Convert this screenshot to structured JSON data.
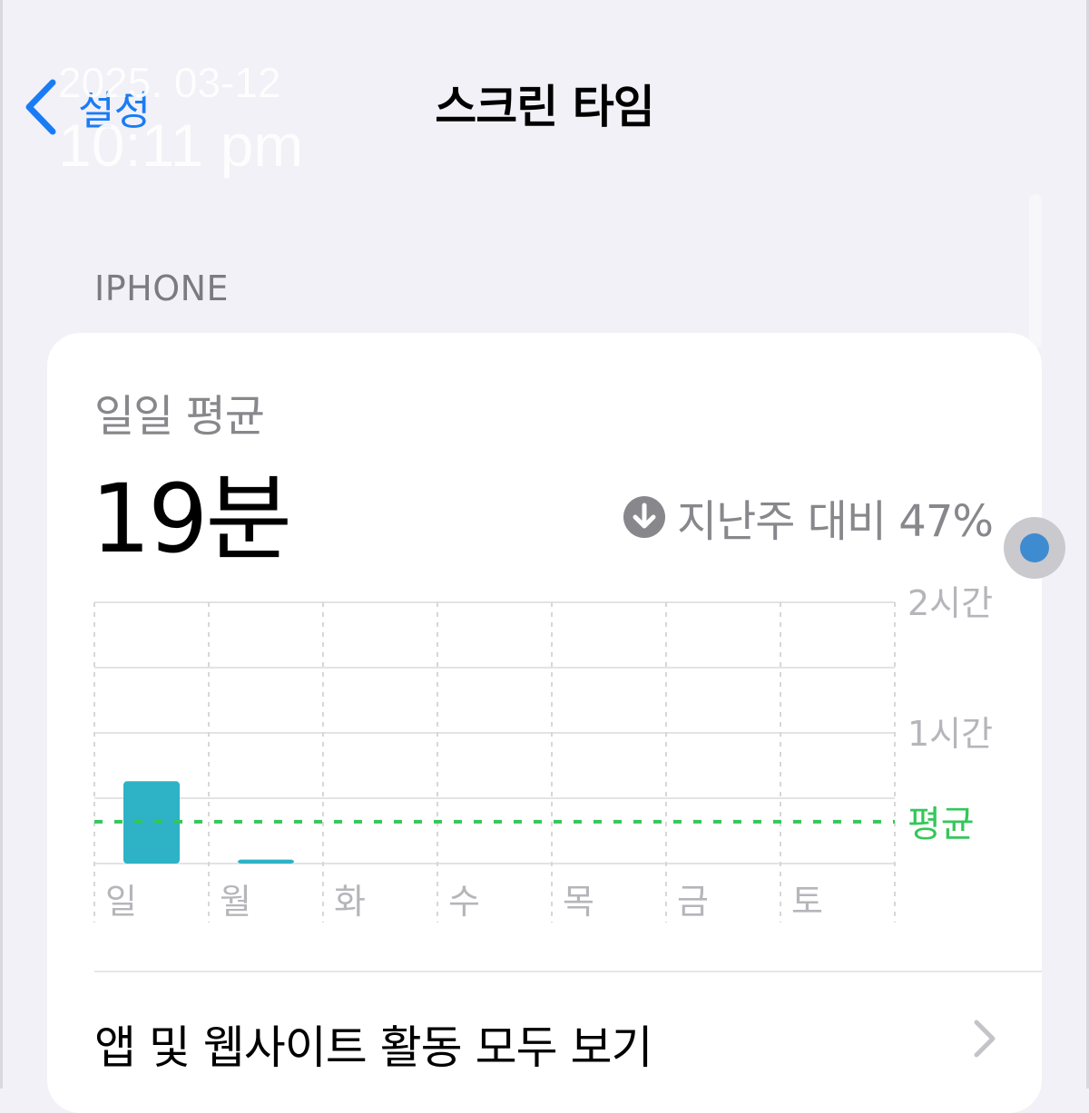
{
  "overlay": {
    "date": "2025. 03-12",
    "time": "10:11 pm"
  },
  "nav": {
    "back_label": "설정",
    "title": "스크린 타임"
  },
  "section": {
    "header": "IPHONE"
  },
  "summary": {
    "label": "일일 평균",
    "value": "19분",
    "comparison": "지난주 대비 47%",
    "comparison_direction": "down"
  },
  "chart_data": {
    "type": "bar",
    "categories": [
      "일",
      "월",
      "화",
      "수",
      "목",
      "금",
      "토"
    ],
    "values": [
      0.63,
      0.03,
      0,
      0,
      0,
      0,
      0
    ],
    "y_unit": "hours",
    "ylim": [
      0,
      2
    ],
    "y_ticks": [
      {
        "value": 2,
        "label": "2시간"
      },
      {
        "value": 1,
        "label": "1시간"
      }
    ],
    "average": {
      "value": 0.32,
      "label": "평균"
    },
    "grid": true,
    "colors": {
      "bar": "#2eb2c6",
      "average": "#34c759",
      "grid": "#e3e3e6"
    }
  },
  "activity_row": {
    "label": "앱 및 웹사이트 활동 모두 보기"
  },
  "colors": {
    "accent": "#1a7cf5",
    "background": "#f2f1f7",
    "card": "#ffffff"
  }
}
